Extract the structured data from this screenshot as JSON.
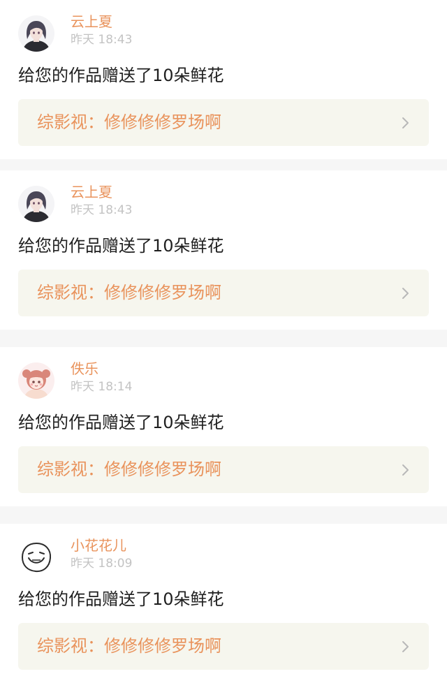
{
  "notifications": [
    {
      "avatar": "dark-haired-girl-avatar",
      "user_name": "云上夏",
      "time": "昨天 18:43",
      "message": "给您的作品赠送了10朵鲜花",
      "work_title": "综影视：修修修修罗场啊"
    },
    {
      "avatar": "dark-haired-girl-avatar",
      "user_name": "云上夏",
      "time": "昨天 18:43",
      "message": "给您的作品赠送了10朵鲜花",
      "work_title": "综影视：修修修修罗场啊"
    },
    {
      "avatar": "pink-anime-girl-avatar",
      "user_name": "佚乐",
      "time": "昨天 18:14",
      "message": "给您的作品赠送了10朵鲜花",
      "work_title": "综影视：修修修修罗场啊"
    },
    {
      "avatar": "doodle-face-avatar",
      "user_name": "小花花儿",
      "time": "昨天 18:09",
      "message": "给您的作品赠送了10朵鲜花",
      "work_title": "综影视：修修修修罗场啊"
    }
  ],
  "colors": {
    "accent": "#e9935c",
    "tab_indicator": "#e8609b",
    "time_text": "#c3c3c3",
    "link_background": "#f6f6ee",
    "page_background": "#f6f6f6"
  },
  "icons": {
    "link_arrow": "chevron-right-icon"
  }
}
